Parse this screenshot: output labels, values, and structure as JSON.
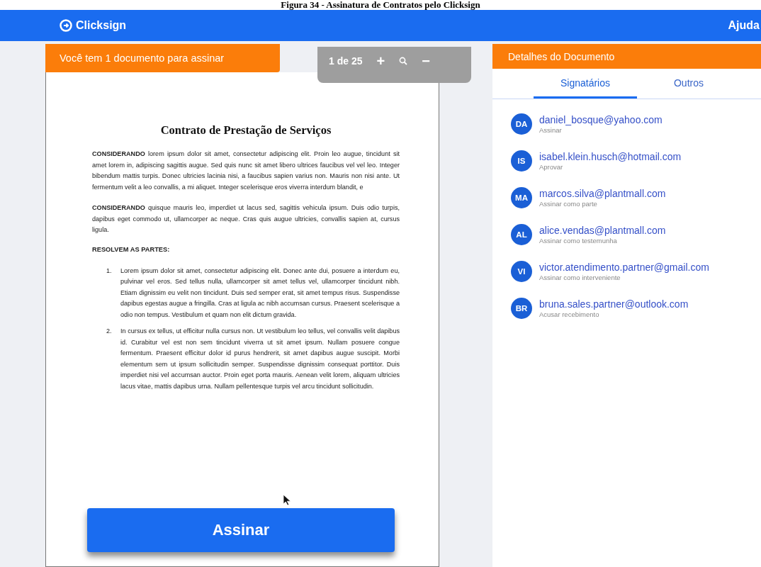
{
  "caption": "Figura 34 - Assinatura de Contratos pelo Clicksign",
  "header": {
    "logo": "Clicksign",
    "help": "Ajuda"
  },
  "banner": "Você tem 1 documento para assinar",
  "toolbar": {
    "page": "1 de 25",
    "zoom_in": "+",
    "zoom_out": "−"
  },
  "document": {
    "title": "Contrato de Prestação de Serviços",
    "paragraphs": [
      "**CONSIDERANDO** lorem ipsum dolor sit amet, consectetur adipiscing elit. Proin leo augue, tincidunt sit amet lorem in, adipiscing sagittis augue. Sed quis nunc sit amet libero ultrices faucibus vel vel leo. Integer bibendum mattis turpis. Donec ultricies lacinia nisi, a faucibus sapien varius non. Mauris non nisi ante. Ut fermentum velit a leo convallis, a mi aliquet. Integer scelerisque eros viverra interdum blandit, e",
      "**CONSIDERANDO** quisque mauris leo, imperdiet ut lacus sed, sagittis vehicula ipsum. Duis odio turpis, dapibus eget commodo ut, ullamcorper ac neque. Cras quis augue ultricies, convallis sapien at, cursus ligula."
    ],
    "heading": "RESOLVEM AS PARTES:",
    "items": [
      {
        "number": "1.",
        "text": "Lorem ipsum dolor sit amet, consectetur adipiscing elit. Donec ante dui, posuere a interdum eu, pulvinar vel eros. Sed tellus nulla, ullamcorper sit amet tellus vel, ullamcorper tincidunt nibh. Etiam dignissim eu velit non tincidunt. Duis sed semper erat, sit amet tempus risus. Suspendisse dapibus egestas augue a fringilla. Cras at ligula ac nibh accumsan cursus. Praesent scelerisque a odio non tempus. Vestibulum et quam non elit dictum gravida."
      },
      {
        "number": "2.",
        "text": "In cursus ex tellus, ut efficitur nulla cursus non. Ut vestibulum leo tellus, vel convallis velit dapibus id. Curabitur vel est non sem tincidunt viverra ut sit amet ipsum. Nullam posuere congue fermentum. Praesent efficitur dolor id purus hendrerit, sit amet dapibus augue suscipit. Morbi elementum sem ut ipsum sollicitudin semper. Suspendisse dignissim consequat porttitor. Duis imperdiet nisi vel accumsan auctor. Proin eget porta mauris. Aenean velit lorem, aliquam ultricies lacus vitae, mattis dapibus urna. Nullam pellentesque turpis vel arcu tincidunt sollicitudin."
      }
    ]
  },
  "sign_button": "Assinar",
  "details": {
    "title": "Detalhes do Documento",
    "tabs": [
      {
        "label": "Signatários",
        "selected": true
      },
      {
        "label": "Outros",
        "selected": false
      }
    ],
    "signers": [
      {
        "initials": "DA",
        "email": "daniel_bosque@yahoo.com",
        "role": "Assinar"
      },
      {
        "initials": "IS",
        "email": "isabel.klein.husch@hotmail.com",
        "role": "Aprovar"
      },
      {
        "initials": "MA",
        "email": "marcos.silva@plantmall.com",
        "role": "Assinar como parte"
      },
      {
        "initials": "AL",
        "email": "alice.vendas@plantmall.com",
        "role": "Assinar como testemunha"
      },
      {
        "initials": "VI",
        "email": "victor.atendimento.partner@gmail.com",
        "role": "Assinar como interveniente"
      },
      {
        "initials": "BR",
        "email": "bruna.sales.partner@outlook.com",
        "role": "Acusar recebimento"
      }
    ]
  }
}
